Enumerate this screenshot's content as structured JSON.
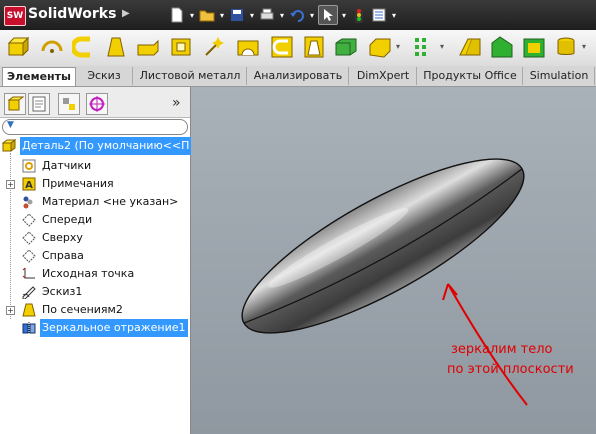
{
  "app": {
    "name": "SolidWorks",
    "logo_text": "SW"
  },
  "ribbon_tabs": [
    {
      "label": "Элементы",
      "active": true
    },
    {
      "label": "Эскиз"
    },
    {
      "label": "Листовой металл"
    },
    {
      "label": "Анализировать"
    },
    {
      "label": "DimXpert"
    },
    {
      "label": "Продукты Office"
    },
    {
      "label": "Simulation"
    }
  ],
  "tree": {
    "root": "Деталь2  (По умолчанию<<П",
    "items": [
      {
        "label": "Датчики",
        "icon": "sensor-icon"
      },
      {
        "label": "Примечания",
        "icon": "annotation-icon"
      },
      {
        "label": "Материал <не указан>",
        "icon": "material-icon"
      },
      {
        "label": "Спереди",
        "icon": "plane-icon"
      },
      {
        "label": "Сверху",
        "icon": "plane-icon"
      },
      {
        "label": "Справа",
        "icon": "plane-icon"
      },
      {
        "label": "Исходная точка",
        "icon": "origin-icon"
      },
      {
        "label": "Эскиз1",
        "icon": "sketch-icon"
      },
      {
        "label": "По сечениям2",
        "icon": "loft-icon"
      },
      {
        "label": "Зеркальное отражение1",
        "icon": "mirror-icon",
        "selected": true
      }
    ]
  },
  "panel": {
    "collapse_glyph": "»",
    "filter_glyph": "▼"
  },
  "annotation": {
    "line1": "зеркалим тело",
    "line2": "по этой плоскости",
    "color": "#e00000"
  },
  "colors": {
    "accent": "#3399ff",
    "titlebar": "#2a2a2a",
    "viewport": "#9ea7b0"
  }
}
